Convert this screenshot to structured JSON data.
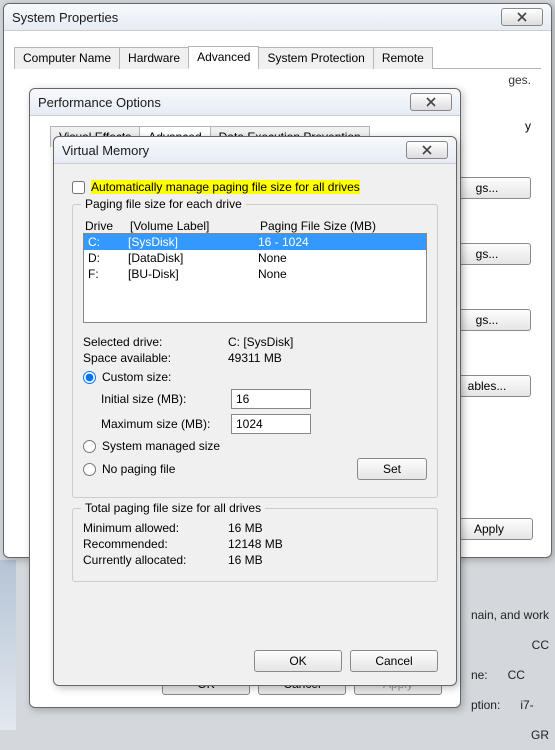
{
  "sysprops": {
    "title": "System Properties",
    "tabs": [
      "Computer Name",
      "Hardware",
      "Advanced",
      "System Protection",
      "Remote"
    ],
    "active_tab": 2,
    "body_hint": "ges.",
    "right_buttons": [
      "y",
      "gs...",
      "gs...",
      "gs...",
      "ables..."
    ],
    "apply": "Apply"
  },
  "perfopts": {
    "title": "Performance Options",
    "tabs": [
      "Visual Effects",
      "Advanced",
      "Data Execution Prevention"
    ],
    "active_tab": 1,
    "ok": "OK",
    "cancel": "Cancel",
    "apply": "Apply"
  },
  "virtmem": {
    "title": "Virtual Memory",
    "auto_manage_label": "Automatically manage paging file size for all drives",
    "auto_manage_checked": false,
    "group_label": "Paging file size for each drive",
    "header_drive": "Drive",
    "header_volume": "[Volume Label]",
    "header_pfs": "Paging File Size (MB)",
    "drives": [
      {
        "letter": "C:",
        "label": "[SysDisk]",
        "size": "16 - 1024",
        "selected": true
      },
      {
        "letter": "D:",
        "label": "[DataDisk]",
        "size": "None",
        "selected": false
      },
      {
        "letter": "F:",
        "label": "[BU-Disk]",
        "size": "None",
        "selected": false
      }
    ],
    "selected_drive_label": "Selected drive:",
    "selected_drive_value": "C:   [SysDisk]",
    "space_label": "Space available:",
    "space_value": "49311 MB",
    "radio_custom": "Custom size:",
    "initial_label": "Initial size (MB):",
    "initial_value": "16",
    "max_label": "Maximum size (MB):",
    "max_value": "1024",
    "radio_system": "System managed size",
    "radio_none": "No paging file",
    "set": "Set",
    "total_label": "Total paging file size for all drives",
    "min_label": "Minimum allowed:",
    "min_value": "16 MB",
    "rec_label": "Recommended:",
    "rec_value": "12148 MB",
    "cur_label": "Currently allocated:",
    "cur_value": "16 MB",
    "ok": "OK",
    "cancel": "Cancel"
  },
  "background": {
    "line1": "nain, and work",
    "line2": "CC",
    "line3_l": "ne:",
    "line3_r": "CC",
    "line4_l": "ption:",
    "line4_r": "i7-",
    "line5": "GR"
  }
}
